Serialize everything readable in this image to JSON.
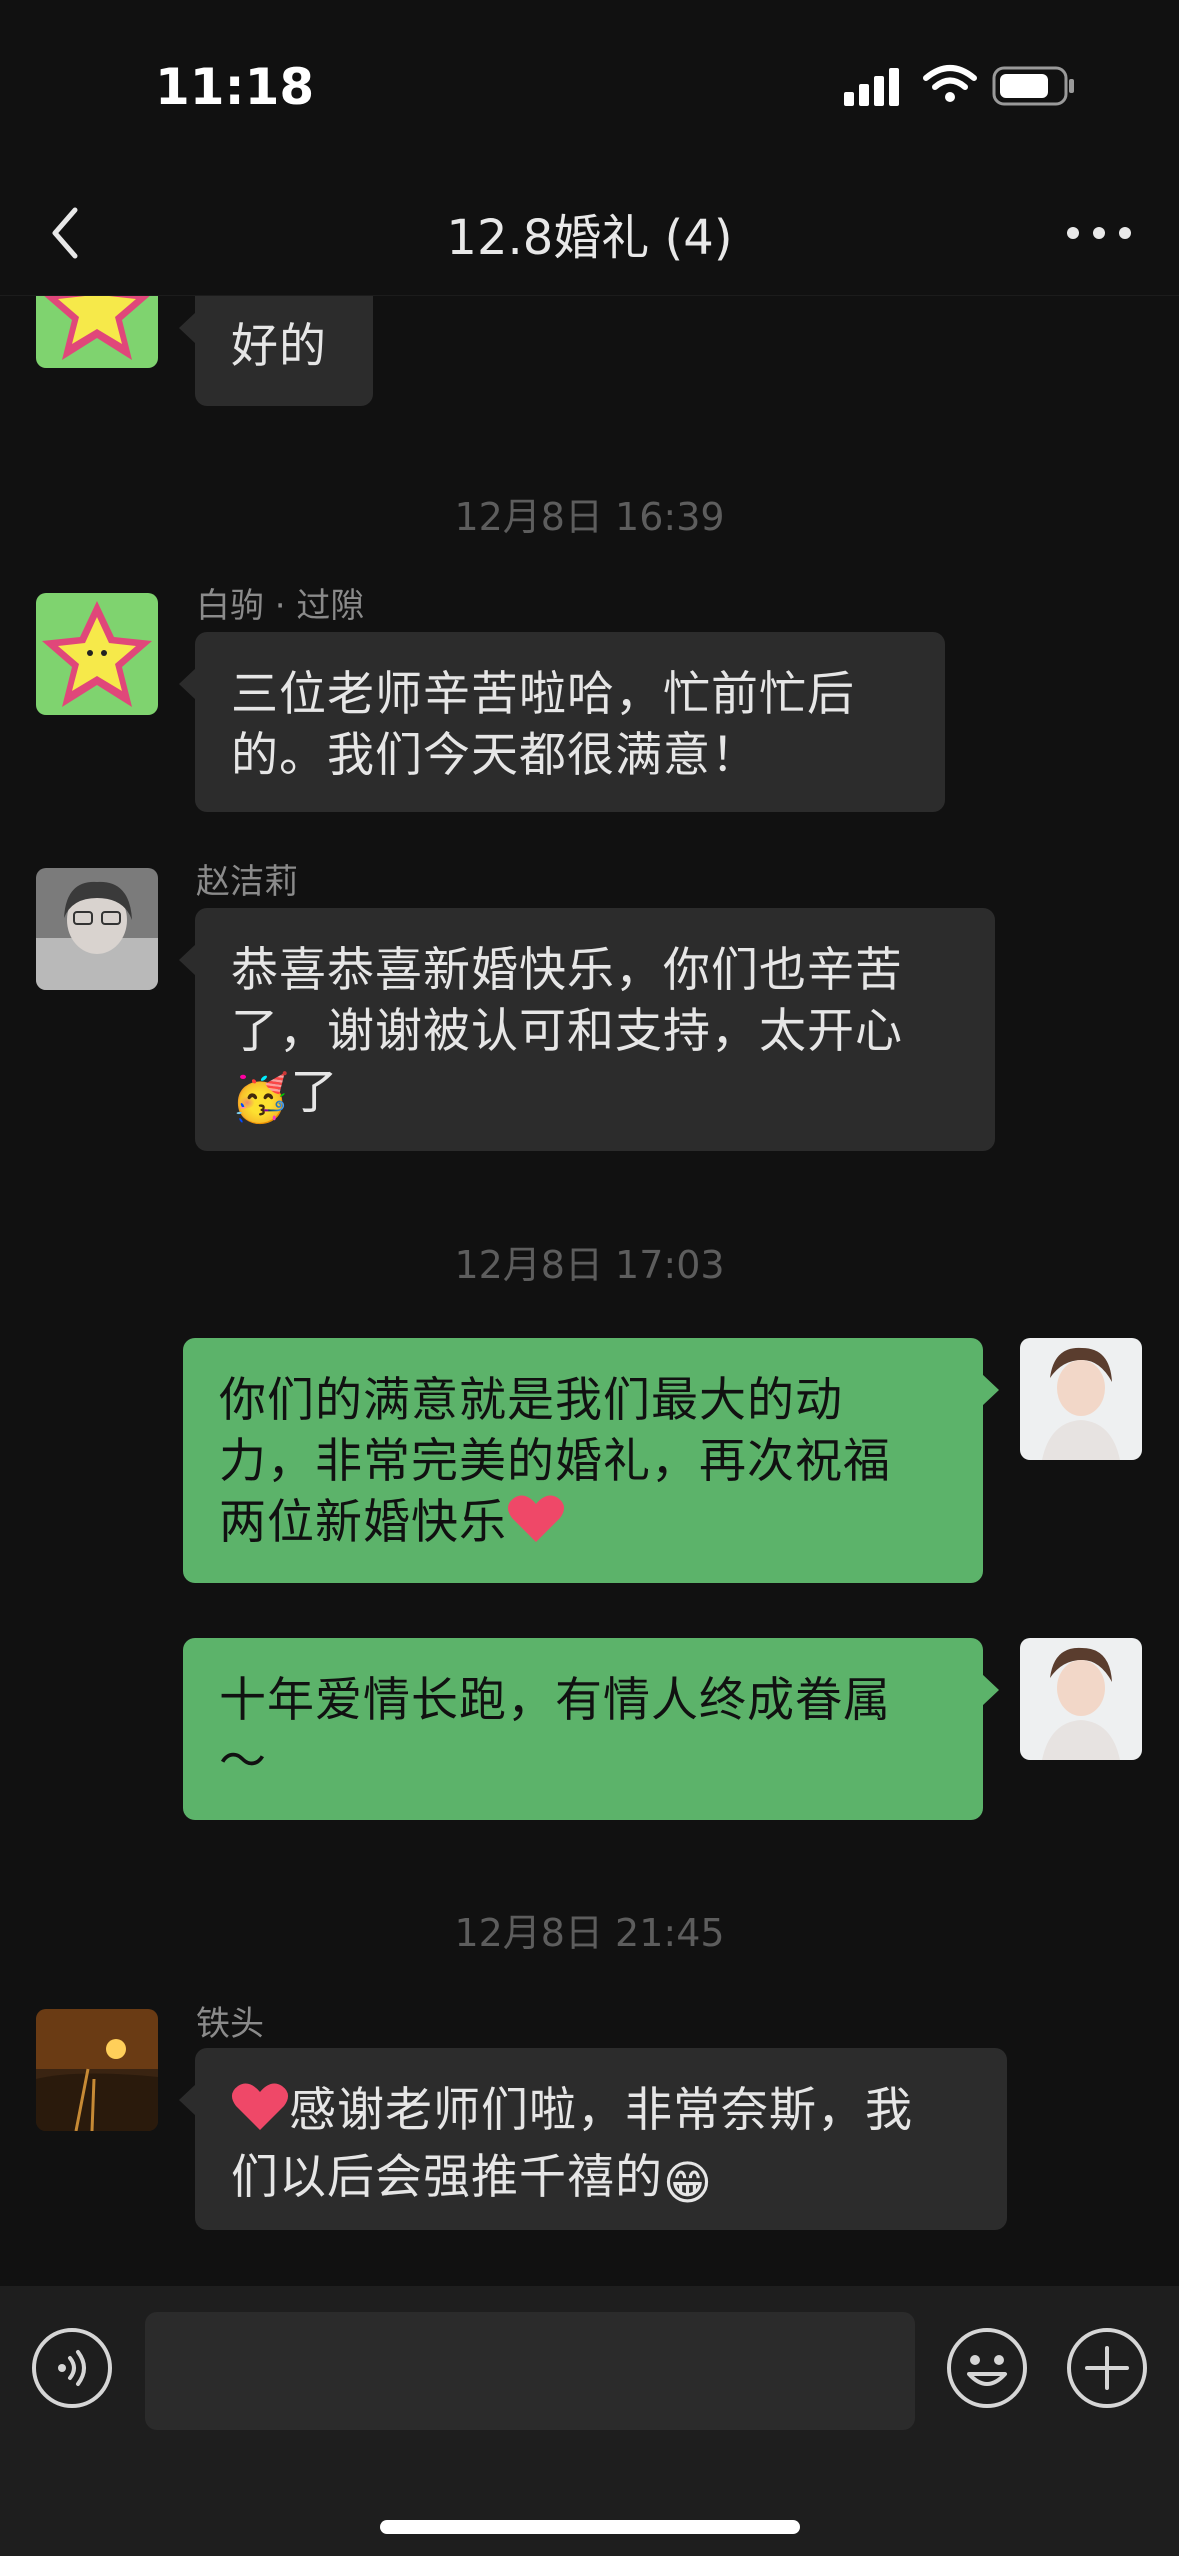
{
  "status_bar": {
    "time": "11:18"
  },
  "nav": {
    "title": "12.8婚礼 (4)"
  },
  "messages": [
    {
      "text": "好的"
    },
    {
      "timestamp": "12月8日 16:39"
    },
    {
      "sender": "白驹 · 过隙",
      "text_line1": "三位老师辛苦啦哈，忙前忙后",
      "text_line2": "的。我们今天都很满意！"
    },
    {
      "sender": "赵洁莉",
      "text_line1": "恭喜恭喜新婚快乐，你们也辛苦",
      "text_line2": "了，谢谢被认可和支持，太开心",
      "text_line3_after_emoji": "了",
      "emoji": "🥳"
    },
    {
      "timestamp": "12月8日 17:03"
    },
    {
      "text_line1": "你们的满意就是我们最大的动",
      "text_line2": "力，非常完美的婚礼，再次祝福",
      "text_line3": "两位新婚快乐"
    },
    {
      "text_line1": "十年爱情长跑，有情人终成眷属",
      "text_line2": "～"
    },
    {
      "timestamp": "12月8日 21:45"
    },
    {
      "sender": "铁头",
      "text_line1_after_heart": "感谢老师们啦，非常奈斯，我",
      "text_line2": "们以后会强推千禧的",
      "emoji": "😁"
    }
  ],
  "colors": {
    "background": "#111111",
    "bubble_left": "#2c2c2c",
    "bubble_right": "#5cb36a"
  },
  "icons": [
    "back-icon",
    "more-icon",
    "voice-icon",
    "emoji-icon",
    "plus-icon",
    "heart-emoji"
  ]
}
